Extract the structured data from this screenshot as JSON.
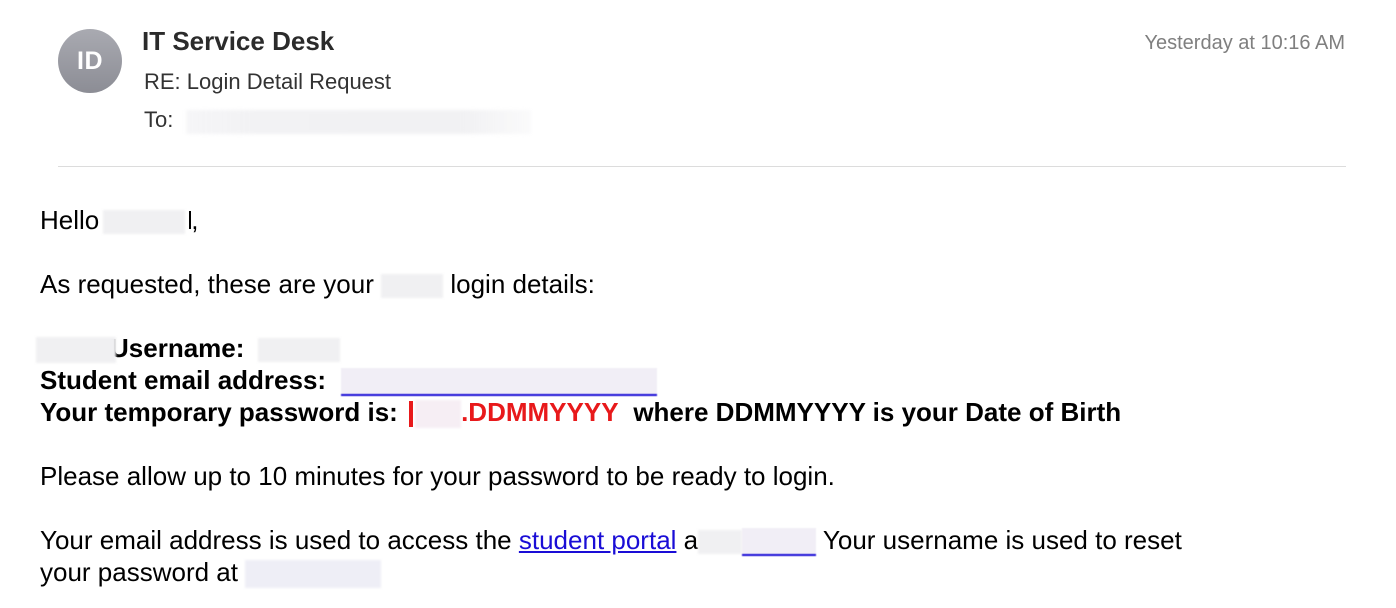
{
  "header": {
    "avatar_initials": "ID",
    "sender": "IT Service Desk",
    "subject": "RE: Login Detail Request",
    "to_label": "To:",
    "timestamp": "Yesterday at 10:16 AM"
  },
  "body": {
    "greeting_prefix": "Hello",
    "greeting_suffix": ",",
    "intro_prefix": "As requested, these are your",
    "intro_suffix": "login details:",
    "username_label": "Username:",
    "email_label": "Student email address:",
    "password_label": "Your temporary password is:",
    "password_value": ".DDMMYYYY",
    "password_note": "where DDMMYYYY is your Date of Birth",
    "allow_text": "Please allow up to 10 minutes for your password to be ready to login.",
    "access_prefix": "Your email address is used to access the",
    "student_portal_link": "student portal",
    "access_middle": "a",
    "access_suffix": "Your username is used to reset",
    "reset_prefix": "your password at"
  },
  "colors": {
    "link": "#1a0dd6",
    "password": "#e8191b",
    "timestamp": "#7f7f7f",
    "avatar": "#9c9da4"
  }
}
